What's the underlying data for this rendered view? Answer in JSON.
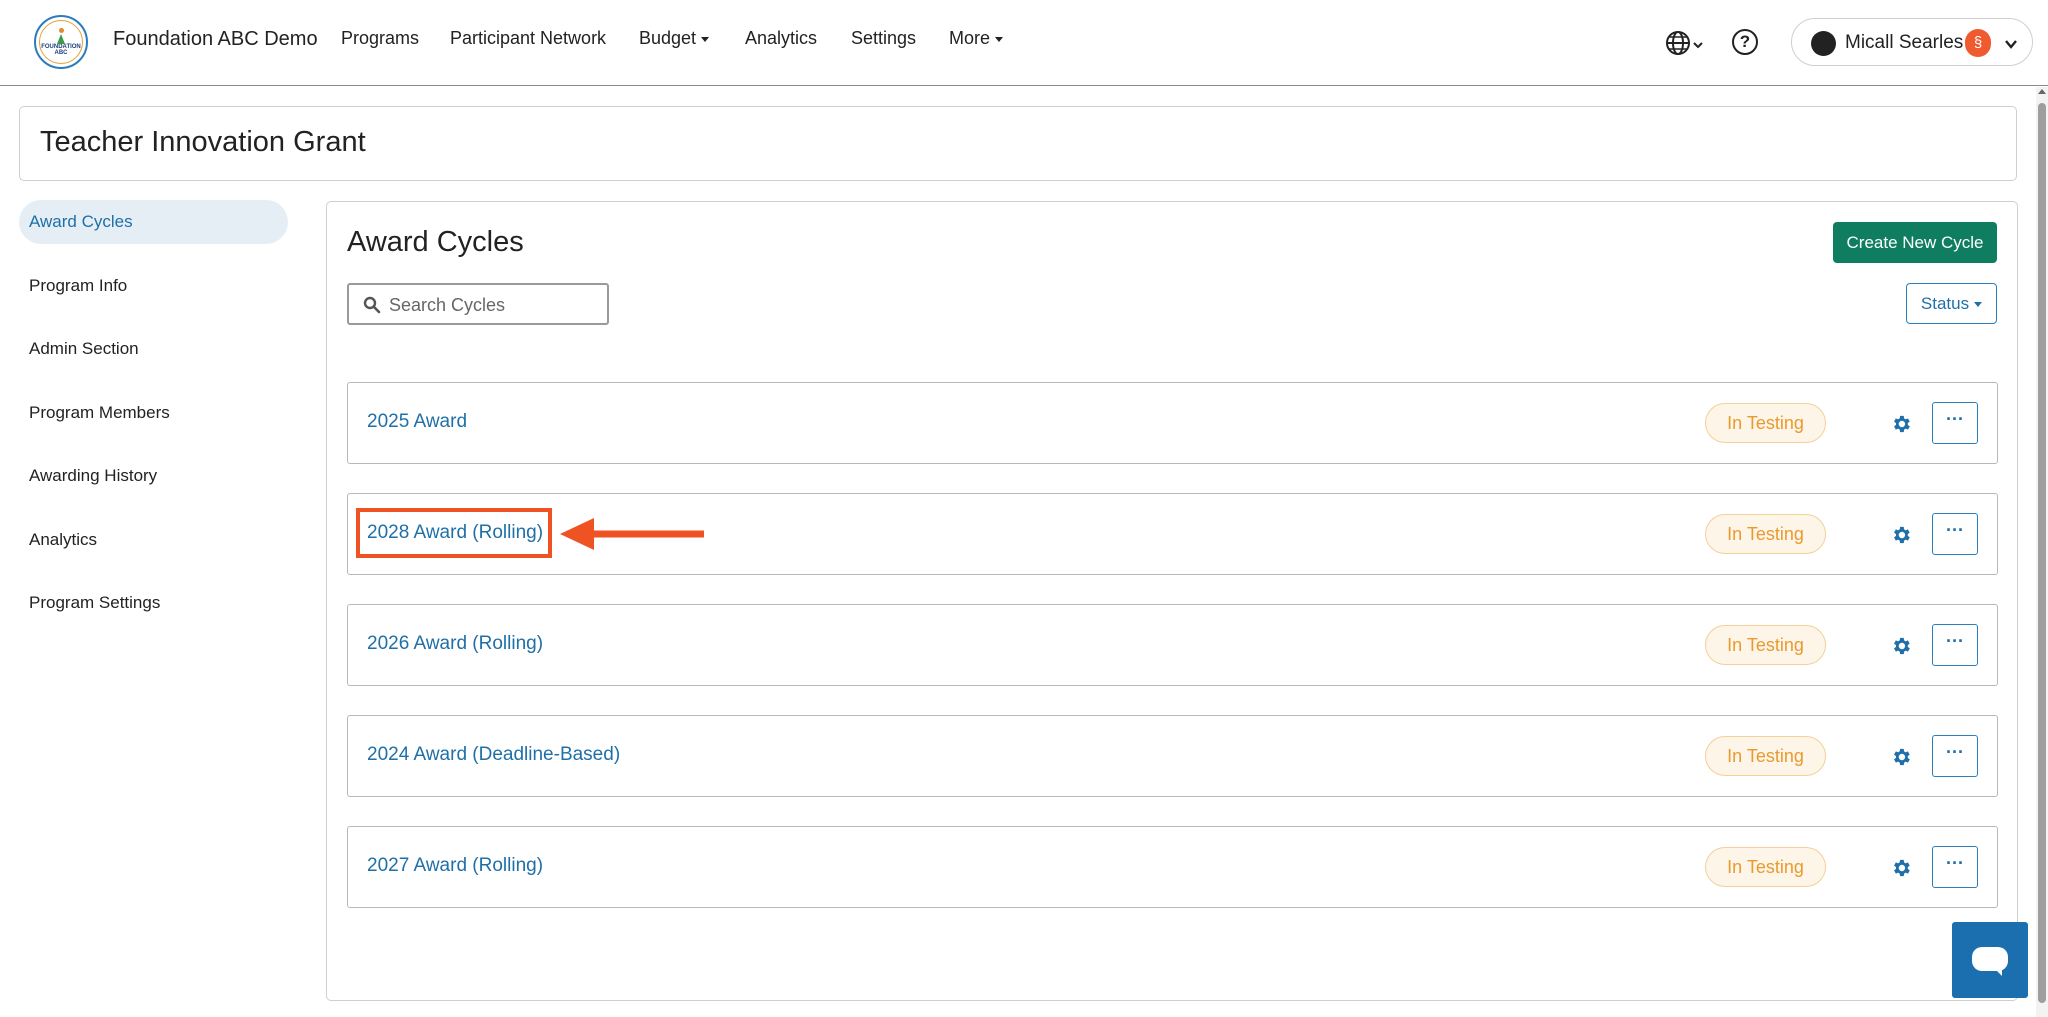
{
  "navbar": {
    "brand": "Foundation ABC Demo",
    "logo_text_line1": "FOUNDATION",
    "logo_text_line2": "ABC",
    "items": [
      {
        "label": "Programs",
        "dropdown": false
      },
      {
        "label": "Participant Network",
        "dropdown": false
      },
      {
        "label": "Budget",
        "dropdown": true
      },
      {
        "label": "Analytics",
        "dropdown": false
      },
      {
        "label": "Settings",
        "dropdown": false
      },
      {
        "label": "More",
        "dropdown": true
      }
    ],
    "language_icon": "globe-icon",
    "help_icon": "question-circle-icon",
    "help_glyph": "?",
    "user": {
      "name": "Micall Searles",
      "badge_glyph": "§",
      "badge_color": "#ef5a2e"
    }
  },
  "program": {
    "title": "Teacher Innovation Grant"
  },
  "sidebar": {
    "items": [
      {
        "label": "Award Cycles",
        "active": true
      },
      {
        "label": "Program Info",
        "active": false
      },
      {
        "label": "Admin Section",
        "active": false
      },
      {
        "label": "Program Members",
        "active": false
      },
      {
        "label": "Awarding History",
        "active": false
      },
      {
        "label": "Analytics",
        "active": false
      },
      {
        "label": "Program Settings",
        "active": false
      }
    ]
  },
  "main": {
    "title": "Award Cycles",
    "create_button": "Create New Cycle",
    "search_placeholder": "Search Cycles",
    "status_filter": "Status",
    "cycles": [
      {
        "name": "2025 Award",
        "status": "In Testing",
        "more_glyph": "···"
      },
      {
        "name": "2028 Award (Rolling)",
        "status": "In Testing",
        "more_glyph": "···",
        "highlighted": true
      },
      {
        "name": "2026 Award (Rolling)",
        "status": "In Testing",
        "more_glyph": "···"
      },
      {
        "name": "2024 Award (Deadline-Based)",
        "status": "In Testing",
        "more_glyph": "···"
      },
      {
        "name": "2027 Award (Rolling)",
        "status": "In Testing",
        "more_glyph": "···"
      }
    ]
  },
  "colors": {
    "accent": "#1f6fa8",
    "primary_button": "#0f7d5f",
    "status_text": "#e99a2f",
    "annotation": "#f05323"
  }
}
